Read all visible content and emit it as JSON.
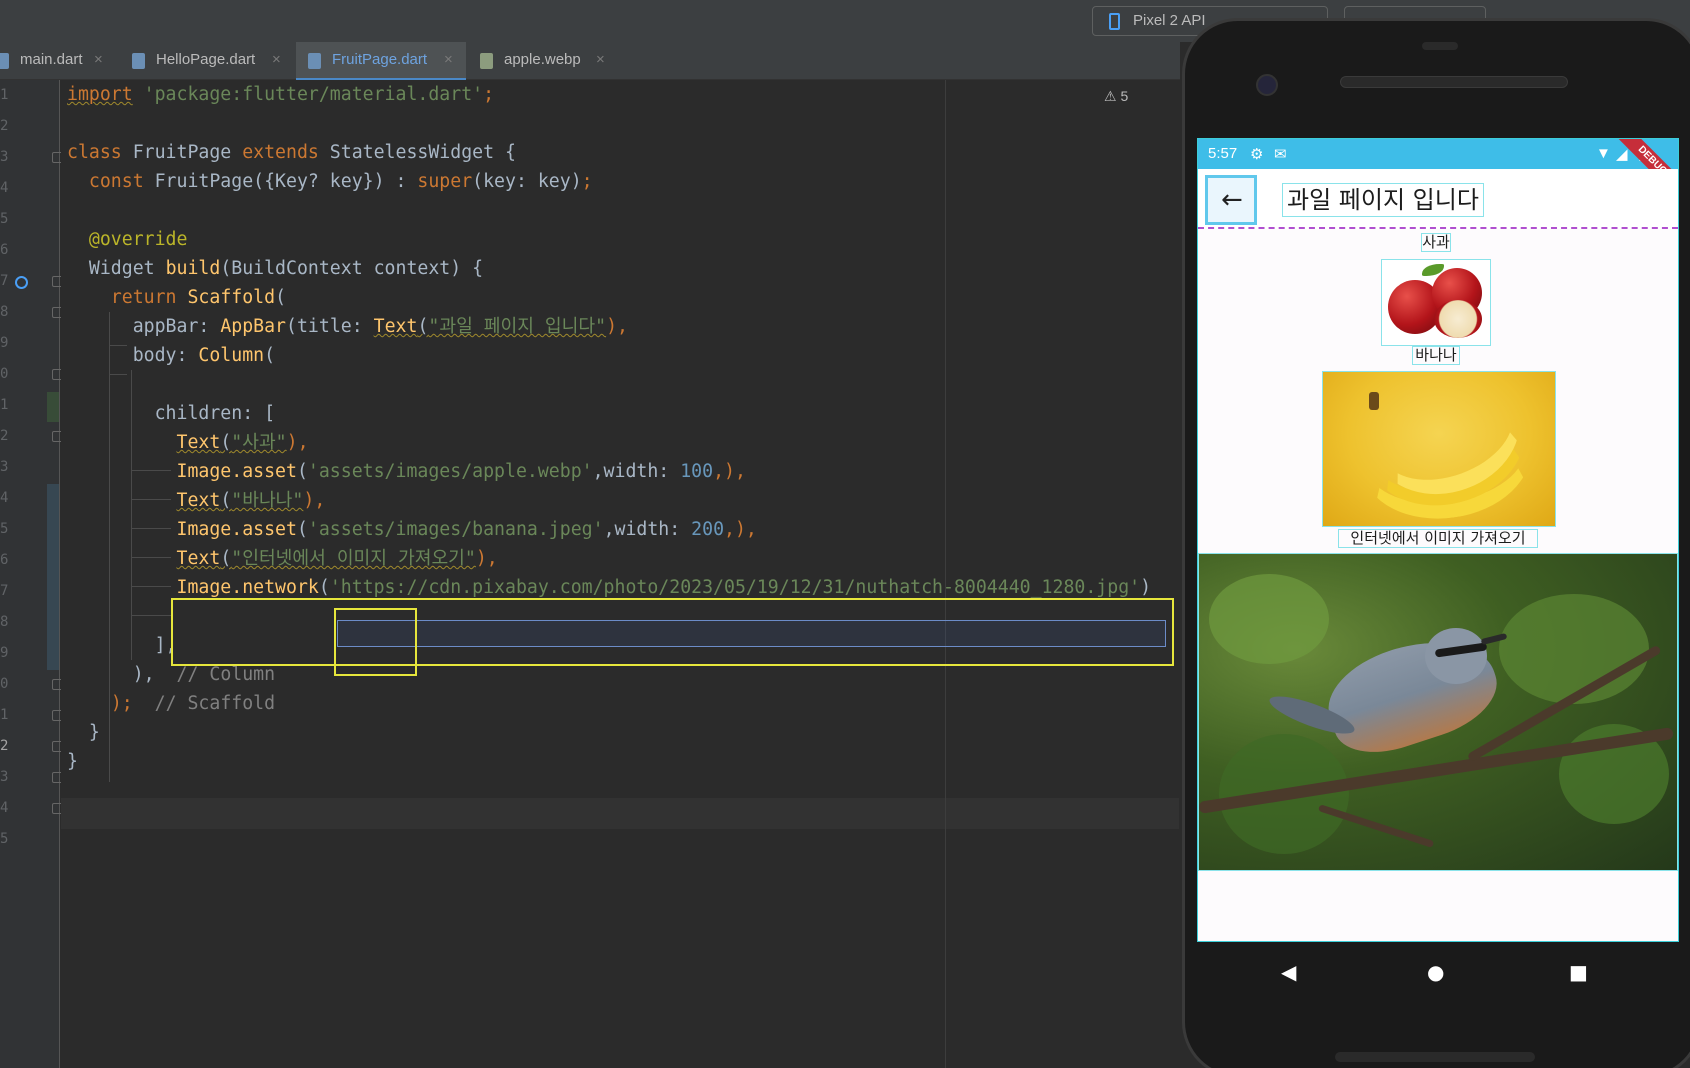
{
  "toolbar": {
    "device": "Pixel 2 API"
  },
  "tabs": [
    {
      "label": "main.dart"
    },
    {
      "label": "HelloPage.dart"
    },
    {
      "label": "FruitPage.dart"
    },
    {
      "label": "apple.webp"
    }
  ],
  "tab_close_glyph": "×",
  "editor": {
    "active_file": "FruitPage.dart",
    "warnings": "5",
    "line_numbers": [
      "1",
      "2",
      "3",
      "4",
      "5",
      "6",
      "7",
      "8",
      "9",
      "0",
      "1",
      "2",
      "3",
      "4",
      "5",
      "6",
      "7",
      "8",
      "9",
      "0",
      "1",
      "2",
      "3",
      "4",
      "5"
    ],
    "lines": {
      "l1_import": "import",
      "l1_pkg": "'package:flutter/material.dart'",
      "l1_end": ";",
      "l3_class": "class",
      "l3_name": " FruitPage ",
      "l3_extends": "extends",
      "l3_rest": " StatelessWidget {",
      "l4_const": "const",
      "l4_ctor": " FruitPage({Key? key}) : ",
      "l4_super": "super",
      "l4_rest": "(key: key)",
      "l4_end": ";",
      "l6_override": "@override",
      "l7_widget": "Widget ",
      "l7_build": "build",
      "l7_rest": "(BuildContext context) {",
      "l8_return": "return",
      "l8_scaffold": "Scaffold",
      "l8_paren": "(",
      "l9_appbar": "appBar: ",
      "l9_appbarcls": "AppBar",
      "l9_title": "(title: ",
      "l9_text": "Text",
      "l9_str": "\"과일 페이지 입니다\"",
      "l9_end": "),",
      "l10_body": "body: ",
      "l10_column": "Column",
      "l10_paren": "(",
      "l12_children": "children: [",
      "l13_text": "Text",
      "l13_str": "\"사과\"",
      "l13_end": "),",
      "l14_image": "Image.asset",
      "l14_str": "'assets/images/apple.webp'",
      "l14_width": ",width: ",
      "l14_num": "100",
      "l14_end": ",),",
      "l15_text": "Text",
      "l15_str": "\"바나나\"",
      "l15_end": "),",
      "l16_image": "Image.asset",
      "l16_str": "'assets/images/banana.jpeg'",
      "l16_width": ",width: ",
      "l16_num": "200",
      "l16_end": ",),",
      "l17_text": "Text",
      "l17_str": "\"인터넷에서 이미지 가져오기\"",
      "l17_end": "),",
      "l18_image": "Image.network",
      "l18_str": "'https://cdn.pixabay.com/photo/2023/05/19/12/31/nuthatch-8004440_1280.jpg'",
      "l18_end": ")",
      "l20_close": "],",
      "l21_close": "),",
      "l21_cmt": "// Column",
      "l22_close": ");",
      "l22_cmt": "// Scaffold",
      "l23_close": "}",
      "l24_close": "}"
    }
  },
  "phone": {
    "status_time": "5:57",
    "debug_label": "DEBUG",
    "appbar_title": "과일 페이지 입니다",
    "back_arrow": "←",
    "apple_label": "사과",
    "banana_label": "바나나",
    "internet_label": "인터넷에서 이미지 가져오기",
    "nav_back": "◀",
    "nav_home": "●",
    "nav_recent": "■"
  },
  "colors": {
    "keyword": "#cc7832",
    "string": "#6a8759",
    "function": "#ffc66d",
    "number": "#6897bb",
    "highlight": "#e6e63c",
    "statusbar": "#3ebde8"
  }
}
